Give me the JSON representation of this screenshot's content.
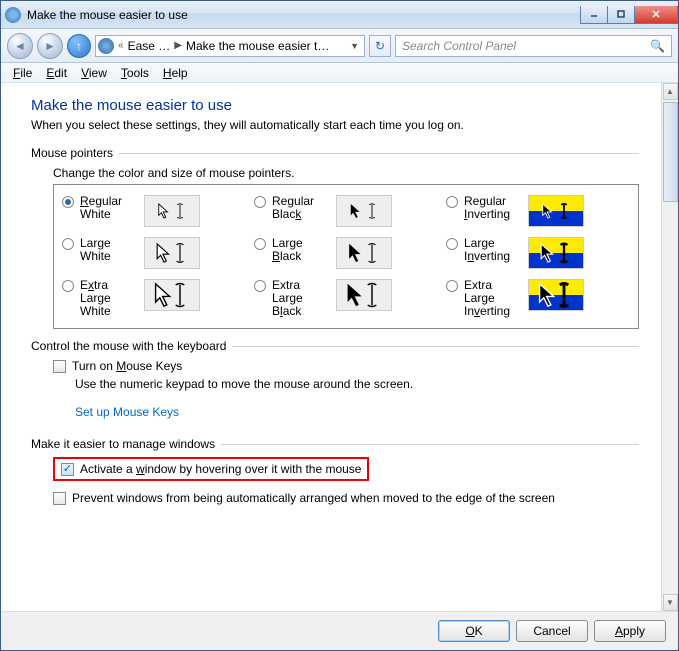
{
  "window": {
    "title": "Make the mouse easier to use"
  },
  "nav": {
    "crumb1": "Ease …",
    "crumb2": "Make the mouse easier t…",
    "search_placeholder": "Search Control Panel"
  },
  "menu": {
    "file": "File",
    "edit": "Edit",
    "view": "View",
    "tools": "Tools",
    "help": "Help"
  },
  "page": {
    "title": "Make the mouse easier to use",
    "subtitle": "When you select these settings, they will automatically start each time you log on."
  },
  "pointers": {
    "heading": "Mouse pointers",
    "desc": "Change the color and size of mouse pointers.",
    "opts": {
      "rw": "Regular White",
      "rb": "Regular Black",
      "ri": "Regular Inverting",
      "lw": "Large White",
      "lb": "Large Black",
      "li": "Large Inverting",
      "xw": "Extra Large White",
      "xb": "Extra Large Black",
      "xi": "Extra Large Inverting"
    }
  },
  "keyboard": {
    "heading": "Control the mouse with the keyboard",
    "chk": "Turn on Mouse Keys",
    "desc": "Use the numeric keypad to move the mouse around the screen.",
    "link": "Set up Mouse Keys"
  },
  "windows": {
    "heading": "Make it easier to manage windows",
    "chk1": "Activate a window by hovering over it with the mouse",
    "chk2": "Prevent windows from being automatically arranged when moved to the edge of the screen"
  },
  "buttons": {
    "ok": "OK",
    "cancel": "Cancel",
    "apply": "Apply"
  }
}
